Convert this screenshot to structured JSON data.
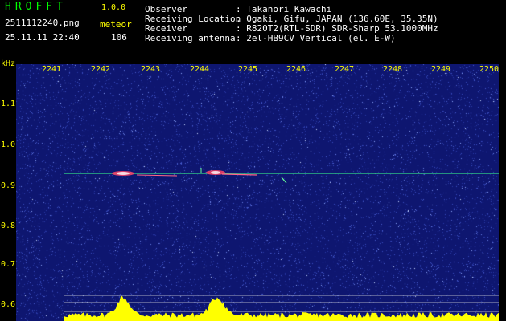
{
  "header": {
    "title": "HROFFT",
    "version": "1.0.0",
    "filename": "2511112240.png",
    "meteor_label": "meteor",
    "datetime": "25.11.11 22:40",
    "meteor_count": "106"
  },
  "metadata": [
    {
      "key": "Observer",
      "value": ": Takanori Kawachi"
    },
    {
      "key": "Receiving Location",
      "value": ": Ogaki, Gifu, JAPAN (136.60E, 35.35N)"
    },
    {
      "key": "Receiver",
      "value": ": R820T2(RTL-SDR) SDR-Sharp 53.1000MHz"
    },
    {
      "key": "Receiving antenna",
      "value": ": 2el-HB9CV Vertical (el. E-W)"
    }
  ],
  "axis": {
    "y_unit": "kHz",
    "x_ticks": [
      "2241",
      "2242",
      "2243",
      "2244",
      "2245",
      "2246",
      "2247",
      "2248",
      "2249",
      "2250"
    ],
    "y_ticks": [
      "1.1",
      "1.0",
      "0.9",
      "0.8",
      "0.7",
      "0.6"
    ]
  },
  "colors": {
    "background": "#000000",
    "text_yellow": "#ffff00",
    "title_green": "#00ff00",
    "plot_bg": "#0e1670",
    "carrier_line": "#33dd88",
    "histogram": "#ffff00"
  }
}
